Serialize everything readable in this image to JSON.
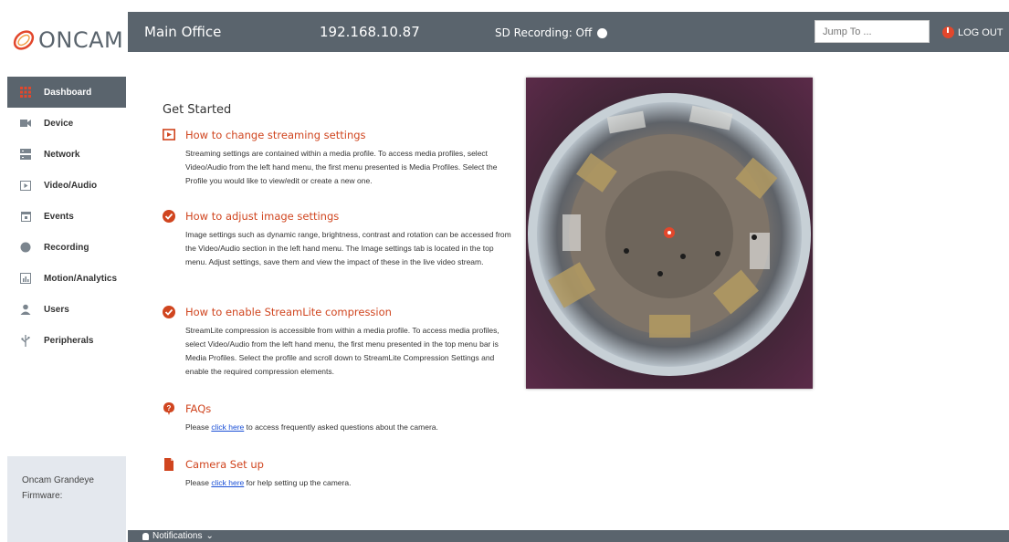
{
  "header": {
    "location": "Main Office",
    "ip": "192.168.10.87",
    "sd_recording": "SD Recording: Off",
    "jump_placeholder": "Jump To ...",
    "logout": "LOG OUT"
  },
  "brand": {
    "name": "ONCAM"
  },
  "colors": {
    "accent": "#d0451f",
    "bar": "#5a646d",
    "sidebar_footer": "#e4e8ee"
  },
  "sidebar": {
    "items": [
      {
        "label": "Dashboard",
        "icon": "grid-icon"
      },
      {
        "label": "Device",
        "icon": "camera-icon"
      },
      {
        "label": "Network",
        "icon": "server-icon"
      },
      {
        "label": "Video/Audio",
        "icon": "play-icon"
      },
      {
        "label": "Events",
        "icon": "calendar-icon"
      },
      {
        "label": "Recording",
        "icon": "record-icon"
      },
      {
        "label": "Motion/Analytics",
        "icon": "chart-icon"
      },
      {
        "label": "Users",
        "icon": "user-icon"
      },
      {
        "label": "Peripherals",
        "icon": "usb-icon"
      }
    ],
    "footer_line1": "Oncam Grandeye",
    "footer_line2": "Firmware:"
  },
  "main": {
    "title": "Get Started",
    "sections": [
      {
        "heading": "How to change streaming settings",
        "icon": "play-icon",
        "text": "Streaming settings are contained within a media profile. To access media profiles, select Video/Audio from the left hand menu, the first menu presented is Media Profiles. Select the Profile you would like to view/edit or create a new one."
      },
      {
        "heading": "How to adjust image settings",
        "icon": "check-icon",
        "text": "Image settings such as dynamic range, brightness, contrast and rotation can be accessed from the Video/Audio section in the left hand menu. The Image settings tab is located in the top menu. Adjust settings, save them and view the impact of these in the live video stream."
      },
      {
        "heading": "How to enable StreamLite compression",
        "icon": "check-icon",
        "text": "StreamLite compression is accessible from within a media profile. To access media profiles, select Video/Audio from the left hand menu, the first menu presented in the top menu bar is Media Profiles. Select the profile and scroll down to StreamLite Compression Settings and enable the required compression elements."
      },
      {
        "heading": "FAQs",
        "icon": "question-icon",
        "text_before": "Please ",
        "link": "click here",
        "text_after": " to access frequently asked questions about the camera."
      },
      {
        "heading": "Camera Set up",
        "icon": "document-icon",
        "text_before": "Please ",
        "link": "click here",
        "text_after": " for help setting up the camera."
      }
    ]
  },
  "notifications": {
    "label": "Notifications"
  }
}
